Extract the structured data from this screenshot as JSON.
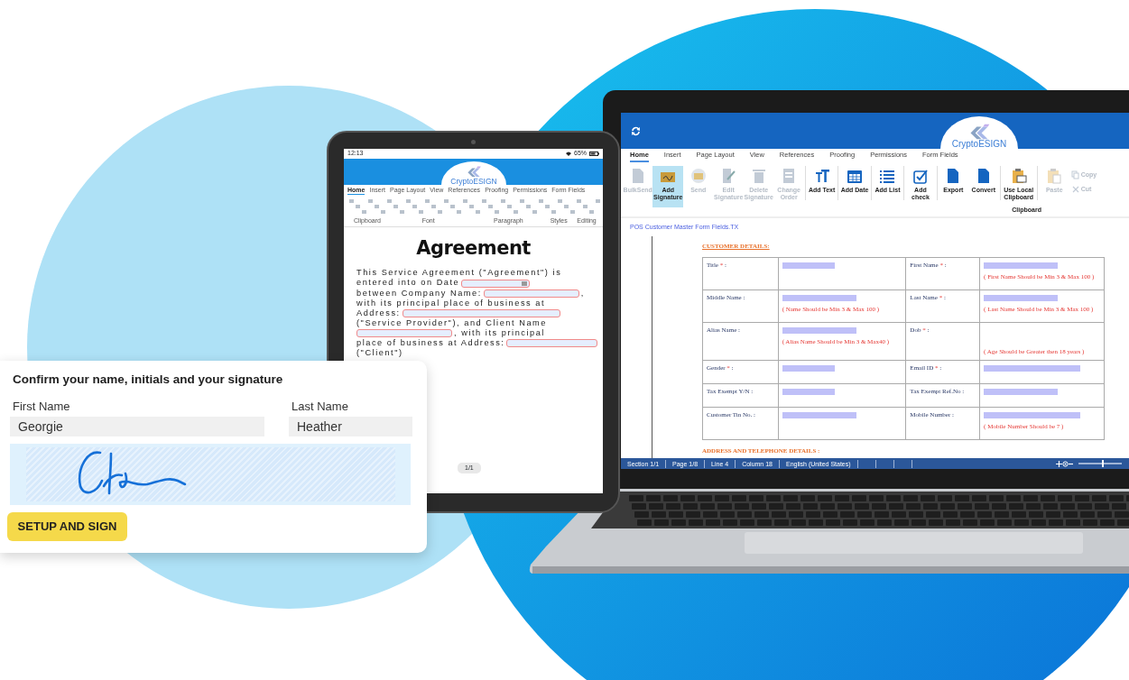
{
  "signature_card": {
    "title": "Confirm your name, initials and your signature",
    "fields": [
      {
        "label": "First Name",
        "value": "Georgie"
      },
      {
        "label": "Last Name",
        "value": "Heather"
      }
    ],
    "button": "SETUP AND SIGN"
  },
  "tablet": {
    "status_bar": {
      "time": "12:13",
      "battery": "65%"
    },
    "logo": "CryptoESIGN",
    "tabs": [
      {
        "label": "Home",
        "selected": true
      },
      {
        "label": "Insert",
        "selected": false
      },
      {
        "label": "Page Layout",
        "selected": false
      },
      {
        "label": "View",
        "selected": false
      },
      {
        "label": "References",
        "selected": false
      },
      {
        "label": "Proofing",
        "selected": false
      },
      {
        "label": "Permissions",
        "selected": false
      },
      {
        "label": "Form Fields",
        "selected": false
      }
    ],
    "ribbon_groups": [
      "Clipboard",
      "Font",
      "Paragraph",
      "Styles",
      "Editing"
    ],
    "document": {
      "title": "Agreement",
      "lines": [
        [
          {
            "kind": "text",
            "text": "This Service Agreement (\"Agreement\") is"
          }
        ],
        [
          {
            "kind": "text",
            "text": "entered into on Date"
          },
          {
            "kind": "date_field"
          }
        ],
        [
          {
            "kind": "text",
            "text": "between Company Name:"
          },
          {
            "kind": "field"
          },
          {
            "kind": "text",
            "text": ","
          }
        ],
        [
          {
            "kind": "text",
            "text": "with its principal place of business at"
          }
        ],
        [
          {
            "kind": "text",
            "text": "Address:"
          },
          {
            "kind": "wide_field"
          }
        ],
        [
          {
            "kind": "text",
            "text": " (\"Service Provider\"), and Client Name"
          }
        ],
        [
          {
            "kind": "field"
          },
          {
            "kind": "text",
            "text": ", with its principal"
          }
        ],
        [
          {
            "kind": "text",
            "text": "place of business at Address:"
          },
          {
            "kind": "field"
          }
        ],
        [
          {
            "kind": "text",
            "text": "(\"Client\")"
          }
        ]
      ]
    },
    "page_indicator": "1/1"
  },
  "laptop": {
    "logo": "CryptoESIGN",
    "tabs": [
      {
        "label": "Home",
        "selected": true
      },
      {
        "label": "Insert",
        "selected": false
      },
      {
        "label": "Page Layout",
        "selected": false
      },
      {
        "label": "View",
        "selected": false
      },
      {
        "label": "References",
        "selected": false
      },
      {
        "label": "Proofing",
        "selected": false
      },
      {
        "label": "Permissions",
        "selected": false
      },
      {
        "label": "Form Fields",
        "selected": false
      }
    ],
    "toolbar": {
      "tools": [
        {
          "label": "BulkSend",
          "kind": "large",
          "disabled": true,
          "selected": false
        },
        {
          "label": "Add Signature",
          "kind": "large",
          "disabled": false,
          "selected": true
        },
        {
          "label": "Send",
          "kind": "large",
          "disabled": true,
          "selected": false
        },
        {
          "label": "Edit Signature",
          "kind": "large",
          "disabled": true,
          "selected": false
        },
        {
          "label": "Delete Signature",
          "kind": "large",
          "disabled": true,
          "selected": false
        },
        {
          "label": "Change Order",
          "kind": "large",
          "disabled": true,
          "selected": false
        },
        {
          "label": "Add Text",
          "kind": "large",
          "disabled": false,
          "selected": false
        },
        {
          "label": "Add Date",
          "kind": "large",
          "disabled": false,
          "selected": false
        },
        {
          "label": "Add List",
          "kind": "large",
          "disabled": false,
          "selected": false
        },
        {
          "label": "Add check",
          "kind": "large",
          "disabled": false,
          "selected": false
        },
        {
          "label": "Export",
          "kind": "large",
          "disabled": false,
          "selected": false
        },
        {
          "label": "Convert",
          "kind": "large",
          "disabled": false,
          "selected": false
        },
        {
          "label": "Use Local Clipboard",
          "kind": "large",
          "disabled": false,
          "selected": false
        },
        {
          "label": "Paste",
          "kind": "large",
          "disabled": true,
          "selected": false
        },
        {
          "label": "Copy",
          "kind": "small",
          "disabled": true,
          "selected": false
        },
        {
          "label": "Cut",
          "kind": "small",
          "disabled": true,
          "selected": false
        }
      ],
      "group_label": "Clipboard"
    },
    "file_name": "POS Customer Master Form Fields.TX",
    "section_title": "CUSTOMER DETAILS:",
    "form_rows": [
      [
        {
          "label": "Title",
          "star": "*",
          "tail": ":",
          "kind": "short"
        },
        {
          "label": "First Name",
          "star": "*",
          "tail": ":",
          "kind": "long",
          "hint": "( First Name Should be Min 3 & Max 100 )"
        }
      ],
      [
        {
          "label": "Middle Name :",
          "kind": "long",
          "hint": "( Name Should be Min 3 & Max 100 )"
        },
        {
          "label": "Last Name",
          "star": "*",
          "tail": ":",
          "kind": "long",
          "hint": "( Last Name Should be Min 3 & Max 100 )"
        }
      ],
      [
        {
          "label": "Alias Name :",
          "kind": "long",
          "hint": "( Alias Name Should be Min 3 & Max40 )"
        },
        {
          "label": "Dob",
          "star": "*",
          "tail": ":",
          "kind": "none",
          "hint": "( Age Should be Greater then 18 years )"
        }
      ],
      [
        {
          "label": "Gender",
          "star": "*",
          "tail": ":",
          "kind": "short"
        },
        {
          "label": "Email ID",
          "star": "*",
          "tail": ":",
          "kind": "wide"
        }
      ],
      [
        {
          "label": "Tax Exempt Y/N :",
          "kind": "short"
        },
        {
          "label": "Tax Exempt Ref.No :",
          "kind": "long"
        }
      ],
      [
        {
          "label": "Customer Tin No. :",
          "kind": "long"
        },
        {
          "label": "Mobile Number :",
          "kind": "wide",
          "hint": "( Mobile Number Should be 7 )"
        }
      ]
    ],
    "next_section": "ADDRESS AND TELEPHONE DETAILS :",
    "status_bar": {
      "items": [
        "Section 1/1",
        "Page 1/8",
        "Line 4",
        "Column 18",
        "English (United States)"
      ],
      "zoom": {
        "level": 0.55
      }
    }
  }
}
